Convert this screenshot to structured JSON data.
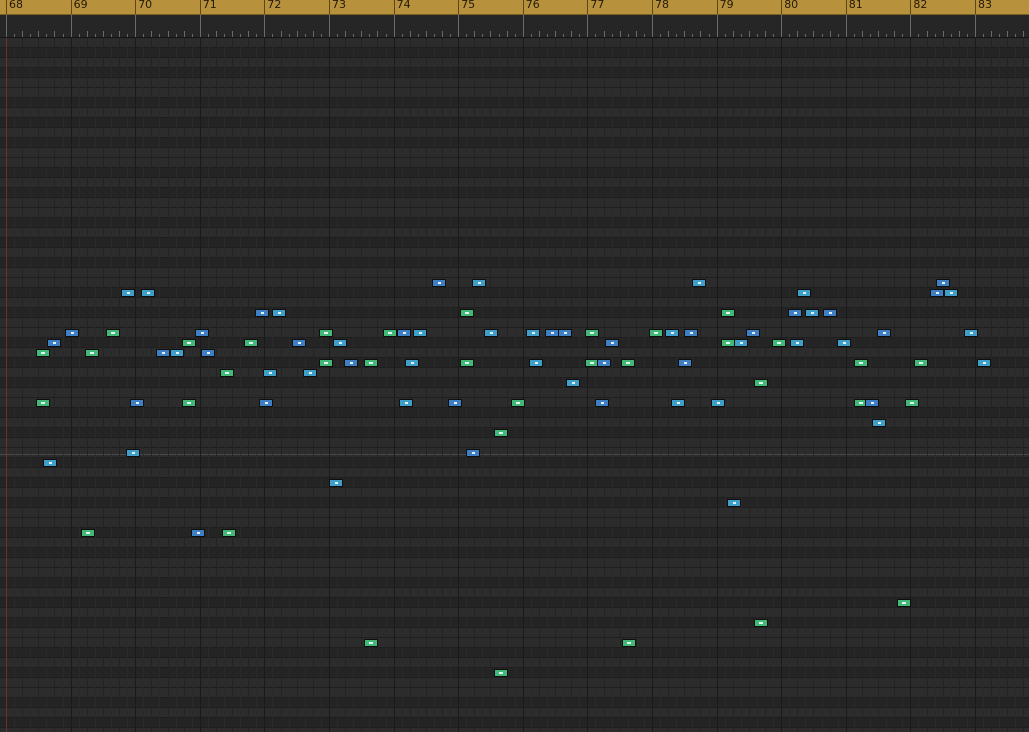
{
  "ruler": {
    "bars": [
      "68",
      "69",
      "70",
      "71",
      "72",
      "73",
      "74",
      "75",
      "76",
      "77",
      "78",
      "79",
      "80",
      "81",
      "82",
      "83"
    ],
    "color": "#b8913c"
  },
  "colors": {
    "background": "#282828",
    "note_blue": "#3f7fc4",
    "note_cyan": "#3f9fc9",
    "note_green": "#43b978"
  },
  "notes": [
    {
      "bar": 68.46,
      "len": 0.22,
      "row": 31,
      "color": "green"
    },
    {
      "bar": 68.46,
      "len": 0.22,
      "row": 36,
      "color": "green"
    },
    {
      "bar": 68.58,
      "len": 0.22,
      "row": 42,
      "color": "cyan"
    },
    {
      "bar": 68.64,
      "len": 0.22,
      "row": 30,
      "color": "blue"
    },
    {
      "bar": 68.92,
      "len": 0.22,
      "row": 29,
      "color": "blue"
    },
    {
      "bar": 69.16,
      "len": 0.22,
      "row": 49,
      "color": "green"
    },
    {
      "bar": 69.22,
      "len": 0.22,
      "row": 31,
      "color": "green"
    },
    {
      "bar": 69.55,
      "len": 0.22,
      "row": 29,
      "color": "green"
    },
    {
      "bar": 69.78,
      "len": 0.22,
      "row": 25,
      "color": "cyan"
    },
    {
      "bar": 69.85,
      "len": 0.22,
      "row": 41,
      "color": "cyan"
    },
    {
      "bar": 69.92,
      "len": 0.22,
      "row": 36,
      "color": "blue"
    },
    {
      "bar": 70.09,
      "len": 0.22,
      "row": 25,
      "color": "cyan"
    },
    {
      "bar": 70.32,
      "len": 0.22,
      "row": 31,
      "color": "blue"
    },
    {
      "bar": 70.54,
      "len": 0.22,
      "row": 31,
      "color": "cyan"
    },
    {
      "bar": 70.72,
      "len": 0.22,
      "row": 30,
      "color": "green"
    },
    {
      "bar": 70.72,
      "len": 0.22,
      "row": 36,
      "color": "green"
    },
    {
      "bar": 70.87,
      "len": 0.22,
      "row": 49,
      "color": "blue"
    },
    {
      "bar": 70.92,
      "len": 0.22,
      "row": 29,
      "color": "blue"
    },
    {
      "bar": 71.02,
      "len": 0.22,
      "row": 31,
      "color": "blue"
    },
    {
      "bar": 71.31,
      "len": 0.22,
      "row": 33,
      "color": "green"
    },
    {
      "bar": 71.34,
      "len": 0.22,
      "row": 49,
      "color": "green"
    },
    {
      "bar": 71.68,
      "len": 0.22,
      "row": 30,
      "color": "green"
    },
    {
      "bar": 71.86,
      "len": 0.22,
      "row": 27,
      "color": "blue"
    },
    {
      "bar": 71.92,
      "len": 0.22,
      "row": 36,
      "color": "blue"
    },
    {
      "bar": 71.98,
      "len": 0.22,
      "row": 33,
      "color": "cyan"
    },
    {
      "bar": 72.12,
      "len": 0.22,
      "row": 27,
      "color": "cyan"
    },
    {
      "bar": 72.42,
      "len": 0.22,
      "row": 30,
      "color": "blue"
    },
    {
      "bar": 72.6,
      "len": 0.22,
      "row": 33,
      "color": "cyan"
    },
    {
      "bar": 72.85,
      "len": 0.22,
      "row": 29,
      "color": "green"
    },
    {
      "bar": 72.85,
      "len": 0.22,
      "row": 32,
      "color": "green"
    },
    {
      "bar": 73.0,
      "len": 0.22,
      "row": 44,
      "color": "cyan"
    },
    {
      "bar": 73.06,
      "len": 0.22,
      "row": 30,
      "color": "cyan"
    },
    {
      "bar": 73.23,
      "len": 0.22,
      "row": 32,
      "color": "blue"
    },
    {
      "bar": 73.54,
      "len": 0.22,
      "row": 32,
      "color": "green"
    },
    {
      "bar": 73.54,
      "len": 0.22,
      "row": 60,
      "color": "green"
    },
    {
      "bar": 73.84,
      "len": 0.22,
      "row": 29,
      "color": "green"
    },
    {
      "bar": 74.06,
      "len": 0.22,
      "row": 29,
      "color": "blue"
    },
    {
      "bar": 74.09,
      "len": 0.22,
      "row": 36,
      "color": "cyan"
    },
    {
      "bar": 74.17,
      "len": 0.22,
      "row": 32,
      "color": "cyan"
    },
    {
      "bar": 74.3,
      "len": 0.22,
      "row": 29,
      "color": "cyan"
    },
    {
      "bar": 74.59,
      "len": 0.22,
      "row": 24,
      "color": "blue"
    },
    {
      "bar": 74.84,
      "len": 0.22,
      "row": 36,
      "color": "blue"
    },
    {
      "bar": 75.03,
      "len": 0.22,
      "row": 27,
      "color": "green"
    },
    {
      "bar": 75.03,
      "len": 0.22,
      "row": 32,
      "color": "green"
    },
    {
      "bar": 75.12,
      "len": 0.22,
      "row": 41,
      "color": "blue"
    },
    {
      "bar": 75.22,
      "len": 0.22,
      "row": 24,
      "color": "cyan"
    },
    {
      "bar": 75.4,
      "len": 0.22,
      "row": 29,
      "color": "cyan"
    },
    {
      "bar": 75.55,
      "len": 0.22,
      "row": 39,
      "color": "green"
    },
    {
      "bar": 75.55,
      "len": 0.22,
      "row": 63,
      "color": "green"
    },
    {
      "bar": 75.82,
      "len": 0.22,
      "row": 36,
      "color": "green"
    },
    {
      "bar": 76.05,
      "len": 0.22,
      "row": 29,
      "color": "cyan"
    },
    {
      "bar": 76.09,
      "len": 0.22,
      "row": 32,
      "color": "cyan"
    },
    {
      "bar": 76.35,
      "len": 0.22,
      "row": 29,
      "color": "blue"
    },
    {
      "bar": 76.55,
      "len": 0.22,
      "row": 29,
      "color": "blue"
    },
    {
      "bar": 76.67,
      "len": 0.22,
      "row": 34,
      "color": "cyan"
    },
    {
      "bar": 76.97,
      "len": 0.22,
      "row": 29,
      "color": "green"
    },
    {
      "bar": 76.97,
      "len": 0.22,
      "row": 32,
      "color": "green"
    },
    {
      "bar": 77.12,
      "len": 0.22,
      "row": 36,
      "color": "blue"
    },
    {
      "bar": 77.15,
      "len": 0.22,
      "row": 32,
      "color": "blue"
    },
    {
      "bar": 77.28,
      "len": 0.22,
      "row": 30,
      "color": "blue"
    },
    {
      "bar": 77.52,
      "len": 0.22,
      "row": 32,
      "color": "green"
    },
    {
      "bar": 77.53,
      "len": 0.22,
      "row": 60,
      "color": "green"
    },
    {
      "bar": 77.96,
      "len": 0.22,
      "row": 29,
      "color": "green"
    },
    {
      "bar": 78.2,
      "len": 0.22,
      "row": 29,
      "color": "cyan"
    },
    {
      "bar": 78.3,
      "len": 0.22,
      "row": 36,
      "color": "cyan"
    },
    {
      "bar": 78.4,
      "len": 0.22,
      "row": 32,
      "color": "blue"
    },
    {
      "bar": 78.5,
      "len": 0.22,
      "row": 29,
      "color": "blue"
    },
    {
      "bar": 78.62,
      "len": 0.22,
      "row": 24,
      "color": "cyan"
    },
    {
      "bar": 78.92,
      "len": 0.22,
      "row": 36,
      "color": "cyan"
    },
    {
      "bar": 79.07,
      "len": 0.22,
      "row": 30,
      "color": "green"
    },
    {
      "bar": 79.07,
      "len": 0.22,
      "row": 27,
      "color": "green"
    },
    {
      "bar": 79.16,
      "len": 0.22,
      "row": 46,
      "color": "cyan"
    },
    {
      "bar": 79.27,
      "len": 0.22,
      "row": 30,
      "color": "cyan"
    },
    {
      "bar": 79.45,
      "len": 0.22,
      "row": 29,
      "color": "blue"
    },
    {
      "bar": 79.58,
      "len": 0.22,
      "row": 34,
      "color": "green"
    },
    {
      "bar": 79.58,
      "len": 0.22,
      "row": 58,
      "color": "green"
    },
    {
      "bar": 79.86,
      "len": 0.22,
      "row": 30,
      "color": "green"
    },
    {
      "bar": 80.1,
      "len": 0.22,
      "row": 27,
      "color": "blue"
    },
    {
      "bar": 80.13,
      "len": 0.22,
      "row": 30,
      "color": "cyan"
    },
    {
      "bar": 80.24,
      "len": 0.22,
      "row": 25,
      "color": "cyan"
    },
    {
      "bar": 80.37,
      "len": 0.22,
      "row": 27,
      "color": "cyan"
    },
    {
      "bar": 80.64,
      "len": 0.22,
      "row": 27,
      "color": "blue"
    },
    {
      "bar": 80.86,
      "len": 0.22,
      "row": 30,
      "color": "cyan"
    },
    {
      "bar": 81.13,
      "len": 0.22,
      "row": 32,
      "color": "green"
    },
    {
      "bar": 81.13,
      "len": 0.22,
      "row": 36,
      "color": "green"
    },
    {
      "bar": 81.3,
      "len": 0.22,
      "row": 36,
      "color": "blue"
    },
    {
      "bar": 81.4,
      "len": 0.22,
      "row": 38,
      "color": "cyan"
    },
    {
      "bar": 81.48,
      "len": 0.22,
      "row": 29,
      "color": "blue"
    },
    {
      "bar": 81.8,
      "len": 0.22,
      "row": 56,
      "color": "green"
    },
    {
      "bar": 81.92,
      "len": 0.22,
      "row": 36,
      "color": "green"
    },
    {
      "bar": 82.05,
      "len": 0.22,
      "row": 32,
      "color": "green"
    },
    {
      "bar": 82.3,
      "len": 0.22,
      "row": 25,
      "color": "blue"
    },
    {
      "bar": 82.4,
      "len": 0.22,
      "row": 24,
      "color": "blue"
    },
    {
      "bar": 82.52,
      "len": 0.22,
      "row": 25,
      "color": "cyan"
    },
    {
      "bar": 82.83,
      "len": 0.22,
      "row": 29,
      "color": "cyan"
    },
    {
      "bar": 83.03,
      "len": 0.22,
      "row": 32,
      "color": "cyan"
    }
  ]
}
